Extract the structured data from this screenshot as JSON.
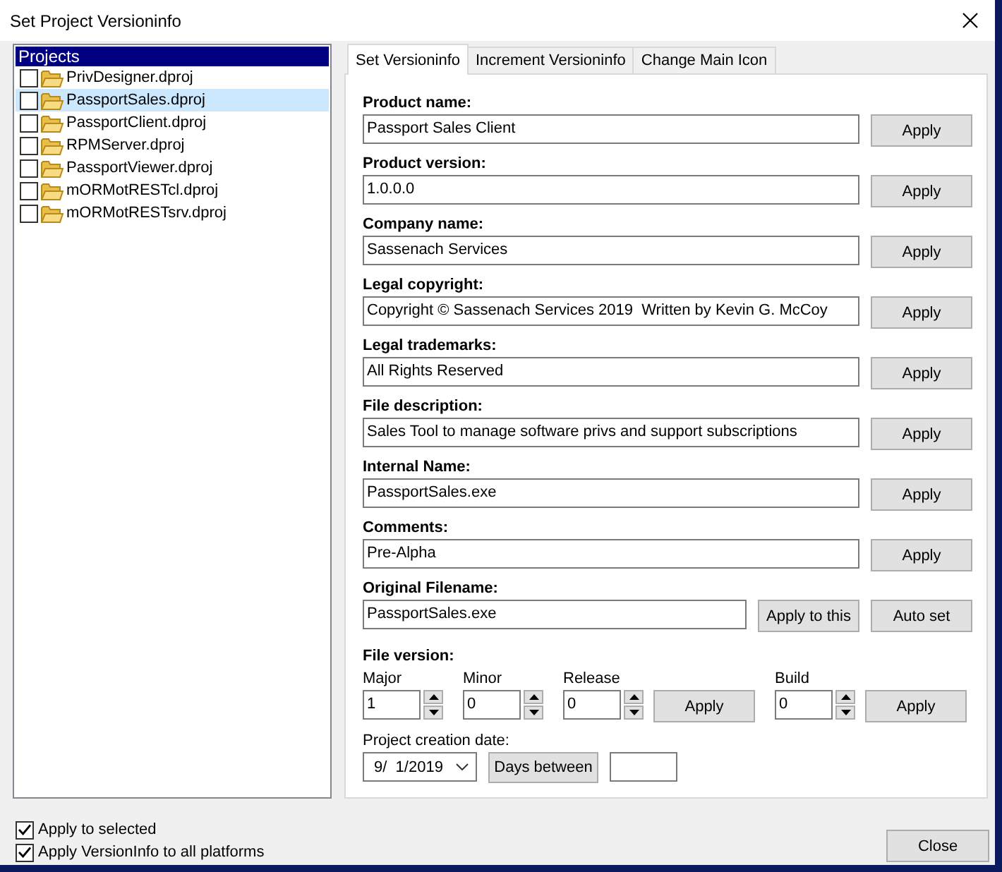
{
  "window": {
    "title": "Set Project Versioninfo"
  },
  "projects": {
    "header": "Projects",
    "items": [
      {
        "name": "PrivDesigner.dproj",
        "checked": false,
        "selected": false
      },
      {
        "name": "PassportSales.dproj",
        "checked": false,
        "selected": true
      },
      {
        "name": "PassportClient.dproj",
        "checked": false,
        "selected": false
      },
      {
        "name": "RPMServer.dproj",
        "checked": false,
        "selected": false
      },
      {
        "name": "PassportViewer.dproj",
        "checked": false,
        "selected": false
      },
      {
        "name": "mORMotRESTcl.dproj",
        "checked": false,
        "selected": false
      },
      {
        "name": "mORMotRESTsrv.dproj",
        "checked": false,
        "selected": false
      }
    ]
  },
  "tabs": [
    {
      "label": "Set Versioninfo",
      "selected": true
    },
    {
      "label": "Increment Versioninfo",
      "selected": false
    },
    {
      "label": "Change Main Icon",
      "selected": false
    }
  ],
  "fields": [
    {
      "label": "Product name:",
      "value": "Passport Sales Client",
      "buttons": [
        "Apply"
      ]
    },
    {
      "label": "Product version:",
      "value": "1.0.0.0",
      "buttons": [
        "Apply"
      ]
    },
    {
      "label": "Company name:",
      "value": "Sassenach Services",
      "buttons": [
        "Apply"
      ]
    },
    {
      "label": "Legal copyright:",
      "value": "Copyright © Sassenach Services 2019  Written by Kevin G. McCoy",
      "buttons": [
        "Apply"
      ]
    },
    {
      "label": "Legal trademarks:",
      "value": "All Rights Reserved",
      "buttons": [
        "Apply"
      ]
    },
    {
      "label": "File description:",
      "value": "Sales Tool to manage software privs and support subscriptions",
      "buttons": [
        "Apply"
      ]
    },
    {
      "label": "Internal Name:",
      "value": "PassportSales.exe",
      "buttons": [
        "Apply"
      ]
    },
    {
      "label": "Comments:",
      "value": "Pre-Alpha",
      "buttons": [
        "Apply"
      ]
    },
    {
      "label": "Original Filename:",
      "value": "PassportSales.exe",
      "buttons": [
        "Apply to this",
        "Auto set"
      ]
    }
  ],
  "file_version": {
    "label": "File version:",
    "parts": [
      {
        "label": "Major",
        "value": "1"
      },
      {
        "label": "Minor",
        "value": "0"
      },
      {
        "label": "Release",
        "value": "0",
        "button": "Apply"
      },
      {
        "label": "Build",
        "value": "0",
        "button": "Apply"
      }
    ]
  },
  "creation_date": {
    "label": "Project creation date:",
    "value": "9/  1/2019",
    "button": "Days between"
  },
  "options": [
    {
      "label": "Apply to selected",
      "checked": true
    },
    {
      "label": "Apply VersionInfo to all platforms",
      "checked": true
    }
  ],
  "close_button": "Close"
}
